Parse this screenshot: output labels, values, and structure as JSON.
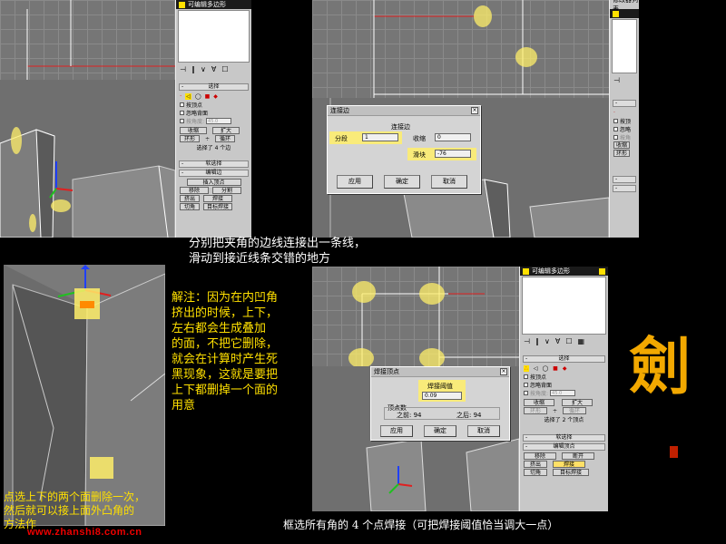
{
  "panel1": {
    "editpoly_title": "可编辑多边形",
    "tool_icons": [
      "pin-icon",
      "modifier-stack-icon",
      "show-end-icon",
      "unique-icon",
      "remove-mod-icon",
      "config-icon"
    ],
    "selection_title": "选择",
    "by_vertex": "按顶点",
    "ignore_backfacing": "忽略背面",
    "by_angle": "按角度:",
    "angle_value": "45.0",
    "shrink": "收缩",
    "grow": "扩大",
    "ring": "环形",
    "loop": "循环",
    "status": "选择了 4 个边",
    "soft_selection": "软选择",
    "edit_edges": "编辑边",
    "insert_vertex": "插入顶点",
    "remove": "移除",
    "split": "分割",
    "extrude": "挤出",
    "weld": "焊接",
    "chamfer": "切角",
    "target_weld": "目标焊接"
  },
  "panel2": {
    "header_fragment": "修改器列表",
    "dialog": {
      "title": "连接边",
      "heading": "连接边",
      "segments_label": "分段",
      "segments_value": "1",
      "pinch_label": "收缩",
      "pinch_value": "0",
      "slide_label": "滑块",
      "slide_value": "-76",
      "apply": "应用",
      "ok": "确定",
      "cancel": "取消"
    },
    "by_vertex": "按顶",
    "ignore_backfacing": "忽略",
    "by_angle": "按角",
    "shrink": "收缩",
    "ring": "环形"
  },
  "caption_top": [
    "分别把夹角的边线连接出一条线，",
    "滑动到接近线条交错的地方"
  ],
  "note": [
    "解注：因为在内凹角",
    "挤出的时候，上下，",
    "左右都会生成叠加",
    "的面，不把它删除，",
    "就会在计算时产生死",
    "黑现象，这就是要把",
    "上下都删掉一个面的",
    "用意"
  ],
  "caption_left": [
    "点选上下的两个面删除一次，",
    "然后就可以接上面外凸角的",
    "方法作"
  ],
  "panel4": {
    "editpoly_title": "可编辑多边形",
    "selection_title": "选择",
    "by_vertex": "按顶点",
    "ignore_backfacing": "忽略背面",
    "by_angle": "按角度:",
    "angle_value": "45.0",
    "shrink": "收缩",
    "grow": "扩大",
    "ring": "环形",
    "loop": "循环",
    "status": "选择了 2 个顶点",
    "soft_selection": "软选择",
    "edit_vertices": "编辑顶点",
    "remove": "移除",
    "break": "断开",
    "extrude": "挤出",
    "weld": "焊接",
    "chamfer": "切角",
    "target_weld": "目标焊接",
    "dialog": {
      "title": "焊接顶点",
      "threshold_label": "焊接阈值",
      "threshold_value": "0.09",
      "count_label": "顶点数",
      "before": "之前: 94",
      "after": "之后: 94",
      "apply": "应用",
      "ok": "确定",
      "cancel": "取消"
    }
  },
  "caption_bottom": "框选所有角的 4 个点焊接（可把焊接阈值恰当调大一点）",
  "logo_char": "劍",
  "watermark": "www.zhanshi8.com.cn"
}
